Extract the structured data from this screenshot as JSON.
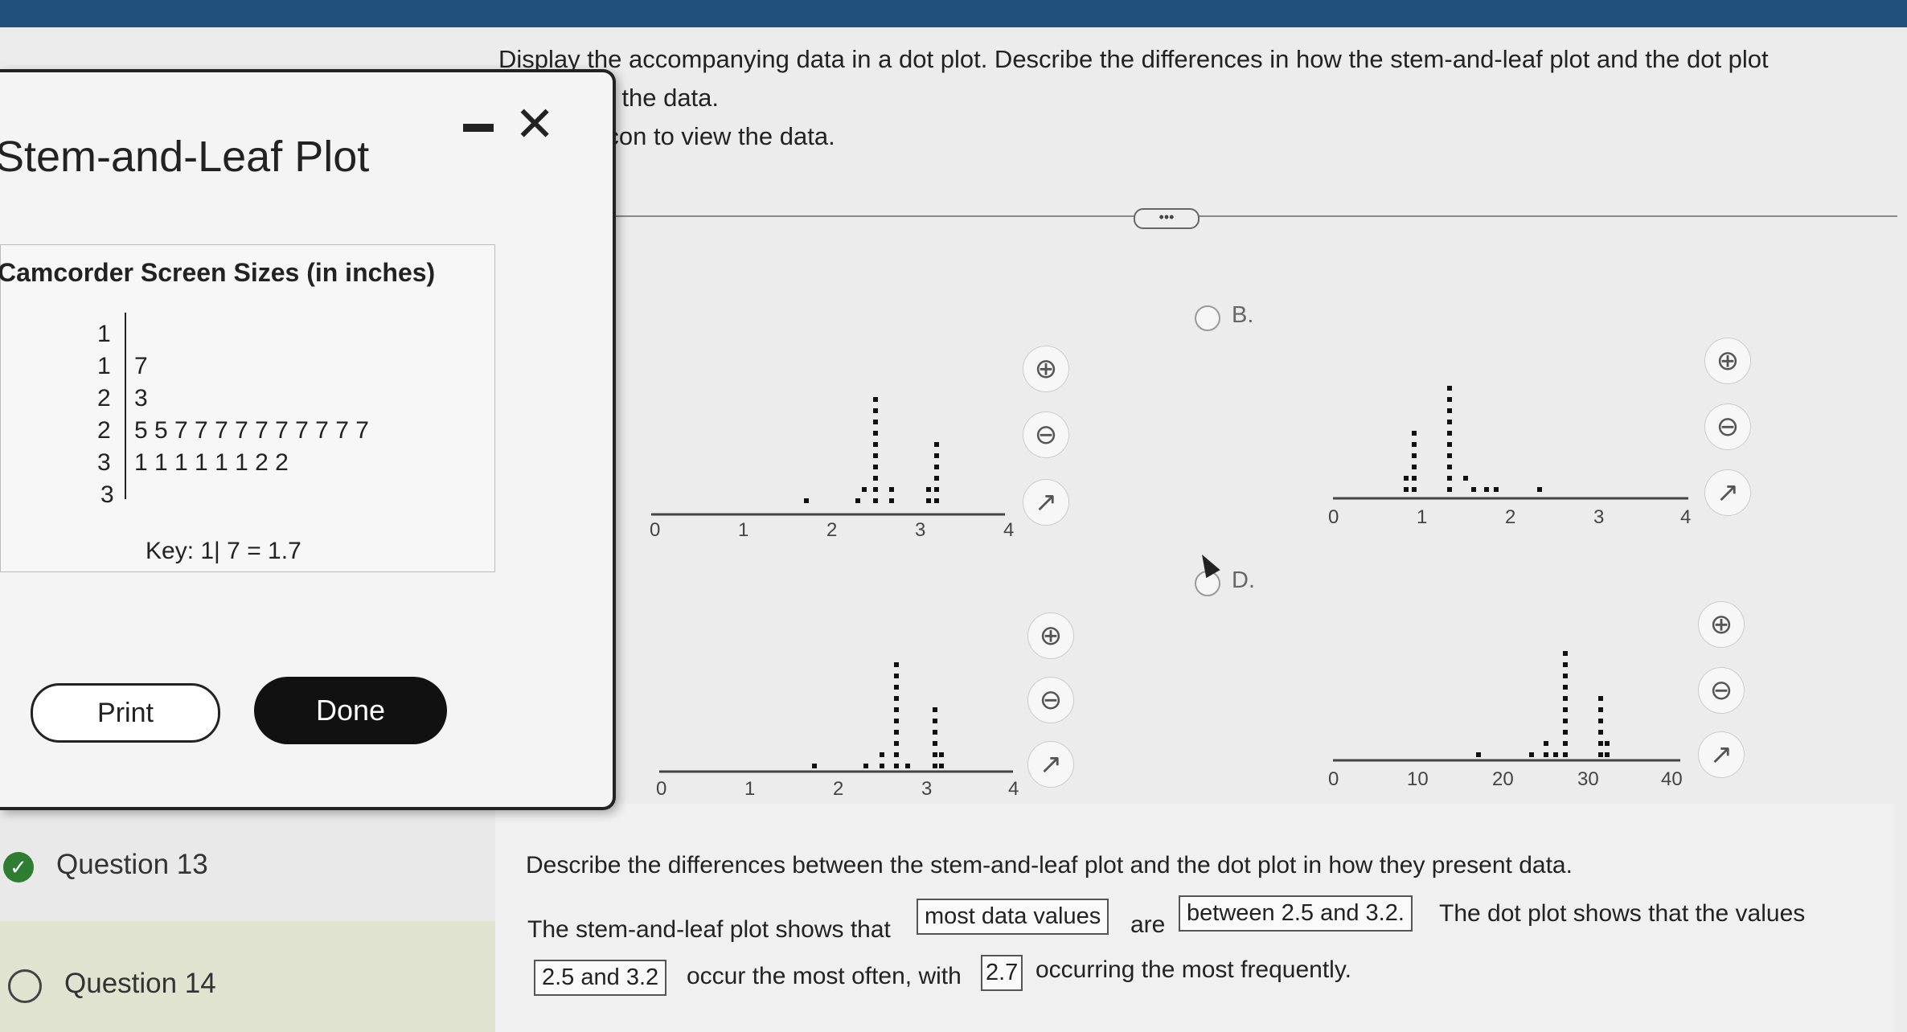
{
  "question": {
    "line1": "Display the accompanying data in a dot plot. Describe the differences in how the stem-and-leaf plot and the dot plot",
    "line2": "patterns in the data.",
    "line3": "Click the icon to view the data.",
    "more": "•••"
  },
  "options": [
    {
      "label": "B.",
      "axis": [
        "0",
        "1",
        "2",
        "3",
        "4"
      ]
    },
    {
      "label": "D.",
      "axis": [
        "0",
        "10",
        "20",
        "30",
        "40"
      ]
    },
    {
      "label": "",
      "axis": [
        "0",
        "1",
        "2",
        "3",
        "4"
      ]
    },
    {
      "label": "",
      "axis": [
        "0",
        "1",
        "2",
        "3",
        "4"
      ]
    }
  ],
  "modal": {
    "title": "Stem-and-Leaf Plot",
    "data_title": "Camcorder Screen Sizes (in inches)",
    "rows": [
      {
        "stem": "1",
        "leaves": ""
      },
      {
        "stem": "1",
        "leaves": "7"
      },
      {
        "stem": "2",
        "leaves": "3"
      },
      {
        "stem": "2",
        "leaves": "5 5 7 7 7 7 7 7 7 7 7 7"
      },
      {
        "stem": "3",
        "leaves": "1 1 1 1 1 1 2 2"
      },
      {
        "stem": "3",
        "leaves": ""
      }
    ],
    "key": "Key: 1| 7 = 1.7",
    "print_label": "Print",
    "done_label": "Done"
  },
  "nav": {
    "q13": "Question 13",
    "q14": "Question 14"
  },
  "answer": {
    "prompt": "Describe the differences between the stem-and-leaf plot and the dot plot in how they present data.",
    "part1": "The stem-and-leaf plot shows that",
    "box1": "most data values",
    "part2": "are",
    "box2": "between 2.5 and 3.2.",
    "part3": "The dot plot shows that the values",
    "box3": "2.5 and 3.2",
    "part4": "occur the most often, with",
    "box4": "2.7",
    "part5": "occurring the most frequently."
  }
}
